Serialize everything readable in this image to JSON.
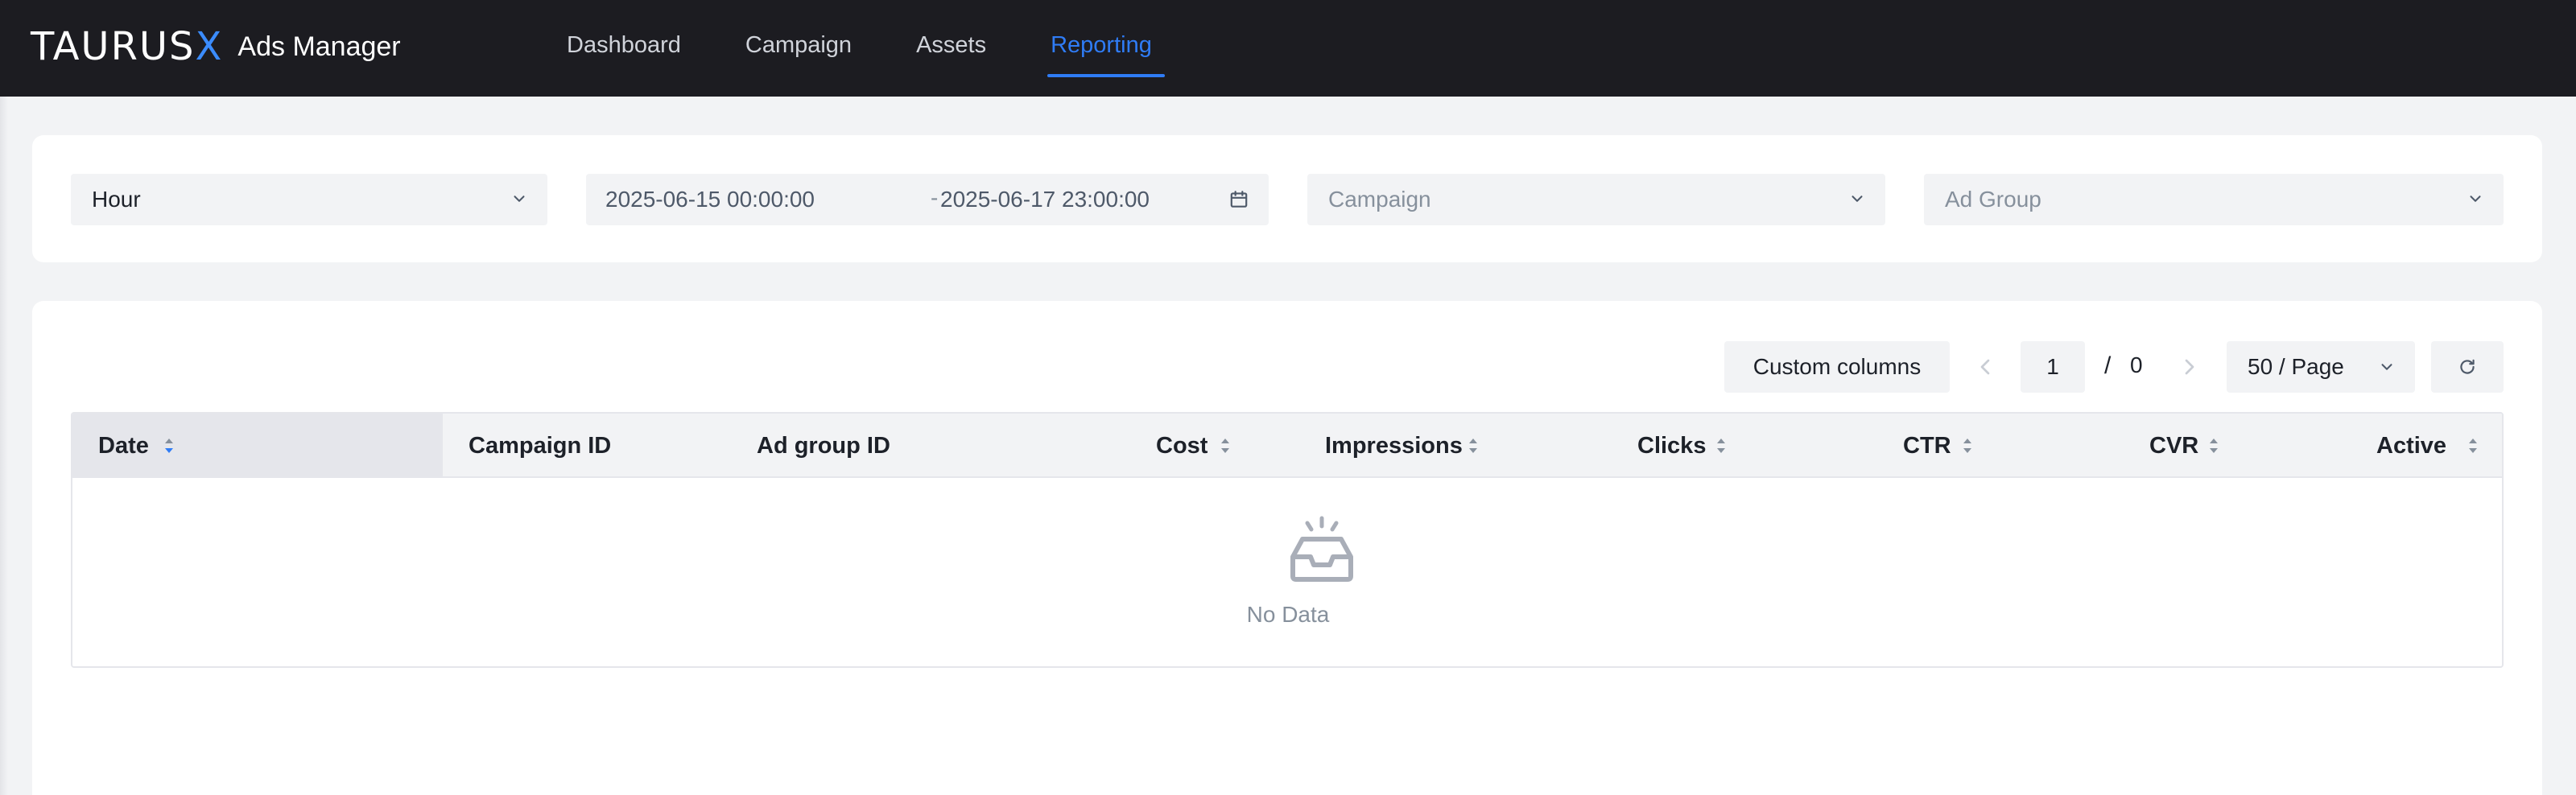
{
  "app": {
    "logo_word": "TAURUS",
    "logo_x": "X",
    "logo_subtitle": "Ads Manager"
  },
  "nav": {
    "items": [
      {
        "label": "Dashboard",
        "active": false
      },
      {
        "label": "Campaign",
        "active": false
      },
      {
        "label": "Assets",
        "active": false
      },
      {
        "label": "Reporting",
        "active": true
      }
    ]
  },
  "filters": {
    "granularity": "Hour",
    "date_start": "2025-06-15 00:00:00",
    "date_separator": "-",
    "date_end": "2025-06-17 23:00:00",
    "campaign_placeholder": "Campaign",
    "ad_group_placeholder": "Ad Group"
  },
  "toolbar": {
    "custom_columns_label": "Custom columns",
    "current_page": "1",
    "page_separator": "/",
    "total_pages": "0",
    "page_size": "50 / Page"
  },
  "table": {
    "columns": [
      "Date",
      "Campaign ID",
      "Ad group ID",
      "Cost",
      "Impressions",
      "Clicks",
      "CTR",
      "CVR",
      "Active"
    ],
    "sorted_column": "Date",
    "rows": [],
    "empty_text": "No Data"
  },
  "colors": {
    "accent": "#2f7cf6",
    "topbar": "#1c1c21",
    "page_bg": "#f2f3f5",
    "muted_text": "#86909c"
  },
  "icons": [
    "chevron-down-icon",
    "calendar-icon",
    "chevron-left-icon",
    "chevron-right-icon",
    "refresh-icon",
    "sort-icon",
    "empty-inbox-icon"
  ]
}
